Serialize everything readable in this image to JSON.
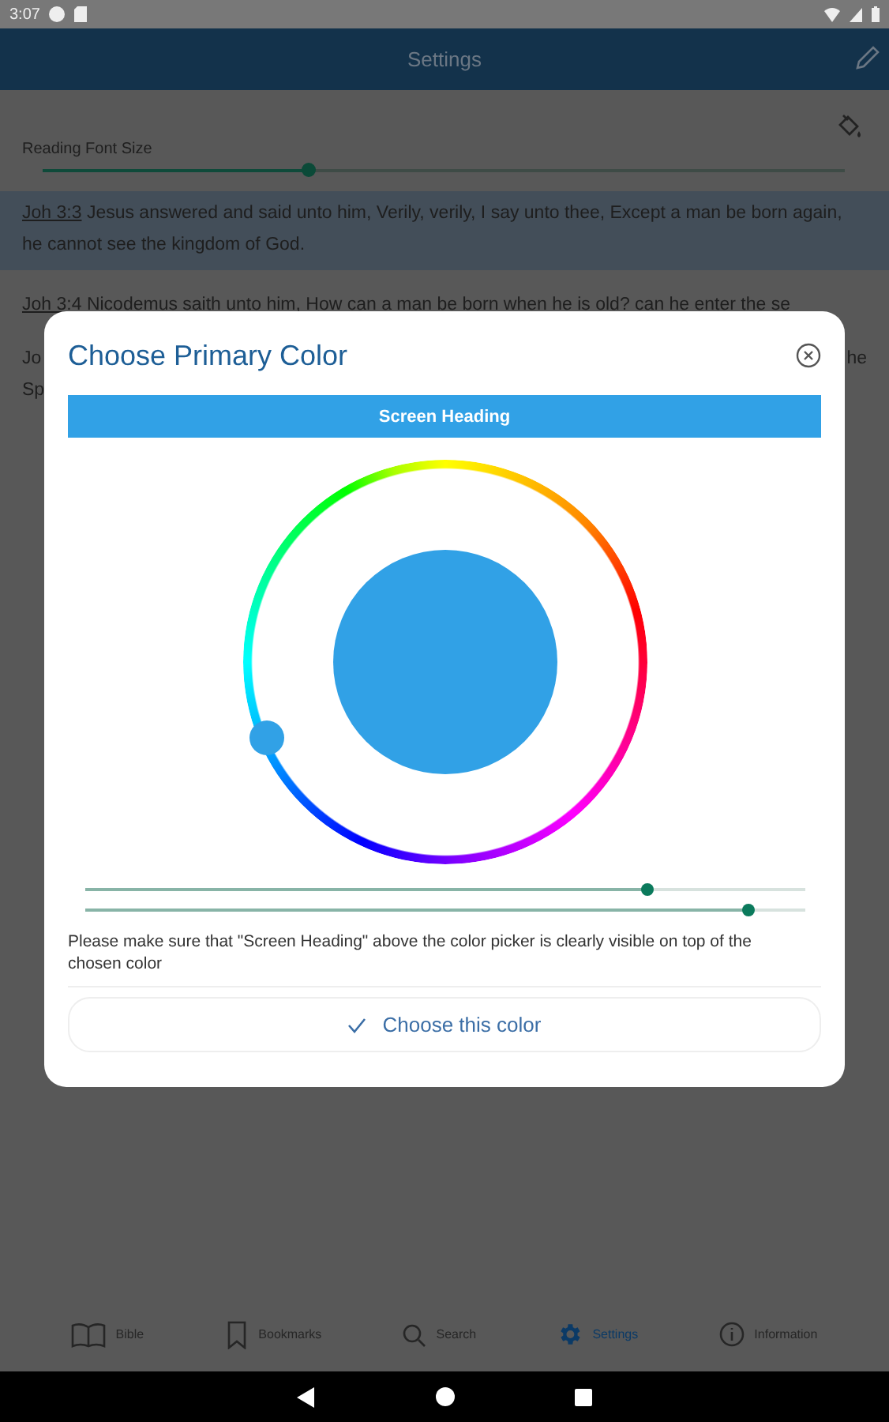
{
  "status_bar": {
    "time": "3:07"
  },
  "app_bar": {
    "title": "Settings"
  },
  "font_size": {
    "label": "Reading Font Size",
    "level": 0.33
  },
  "verses": [
    {
      "ref": "Joh 3:3",
      "text": "Jesus answered and said unto him, Verily, verily, I say unto thee, Except a man be born again, he cannot see the kingdom of God.",
      "selected": true
    },
    {
      "ref": "Joh 3:4",
      "text": "Nicodemus saith unto him, How can a man be born when he is old? can he enter the se",
      "selected": false
    }
  ],
  "hidden_fragments": {
    "left": "Jo",
    "right": "he",
    "second_line": "Sp"
  },
  "dialog": {
    "title": "Choose Primary Color",
    "heading": "Screen Heading",
    "color": "#31a1e6",
    "hue_sliders": [
      {
        "level": 0.78
      },
      {
        "level": 0.92
      }
    ],
    "note": "Please make sure that \"Screen Heading\" above the color picker is clearly visible on top of the chosen color",
    "button": "Choose this color"
  },
  "bottom_nav": [
    {
      "label": "Bible",
      "selected": false
    },
    {
      "label": "Bookmarks",
      "selected": false
    },
    {
      "label": "Search",
      "selected": false
    },
    {
      "label": "Settings",
      "selected": true
    },
    {
      "label": "Information",
      "selected": false
    }
  ]
}
